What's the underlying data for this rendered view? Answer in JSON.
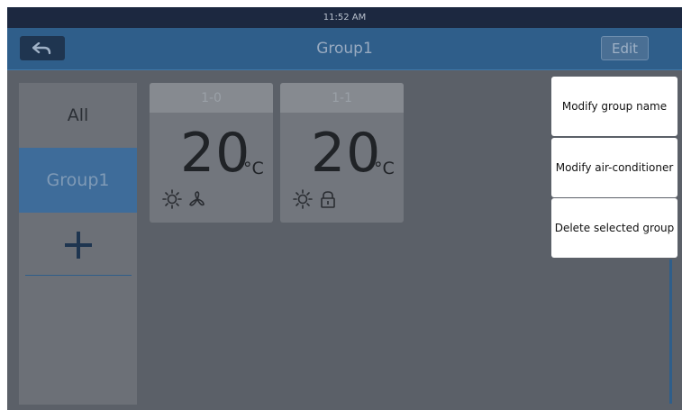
{
  "status_bar": {
    "time": "11:52 AM"
  },
  "header": {
    "back_icon": "back-arrow-icon",
    "title": "Group1",
    "edit_label": "Edit"
  },
  "sidebar": {
    "items": [
      {
        "label": "All"
      },
      {
        "label": "Group1",
        "selected": true
      }
    ],
    "add_icon": "plus-icon"
  },
  "cards": [
    {
      "id": "1-0",
      "temperature": "20",
      "unit": "°C",
      "icons": [
        "sun-icon",
        "fan-icon"
      ]
    },
    {
      "id": "1-1",
      "temperature": "20",
      "unit": "°C",
      "icons": [
        "sun-icon",
        "lock-icon"
      ]
    }
  ],
  "context_menu": {
    "items": [
      {
        "label": "Modify group name"
      },
      {
        "label": "Modify air-conditioner"
      },
      {
        "label": "Delete selected group"
      }
    ]
  },
  "colors": {
    "title_bar": "#2f5e8a",
    "status_bar": "#1c2840",
    "selected_item": "#3e6c9a",
    "overlay": "#5b6068"
  }
}
